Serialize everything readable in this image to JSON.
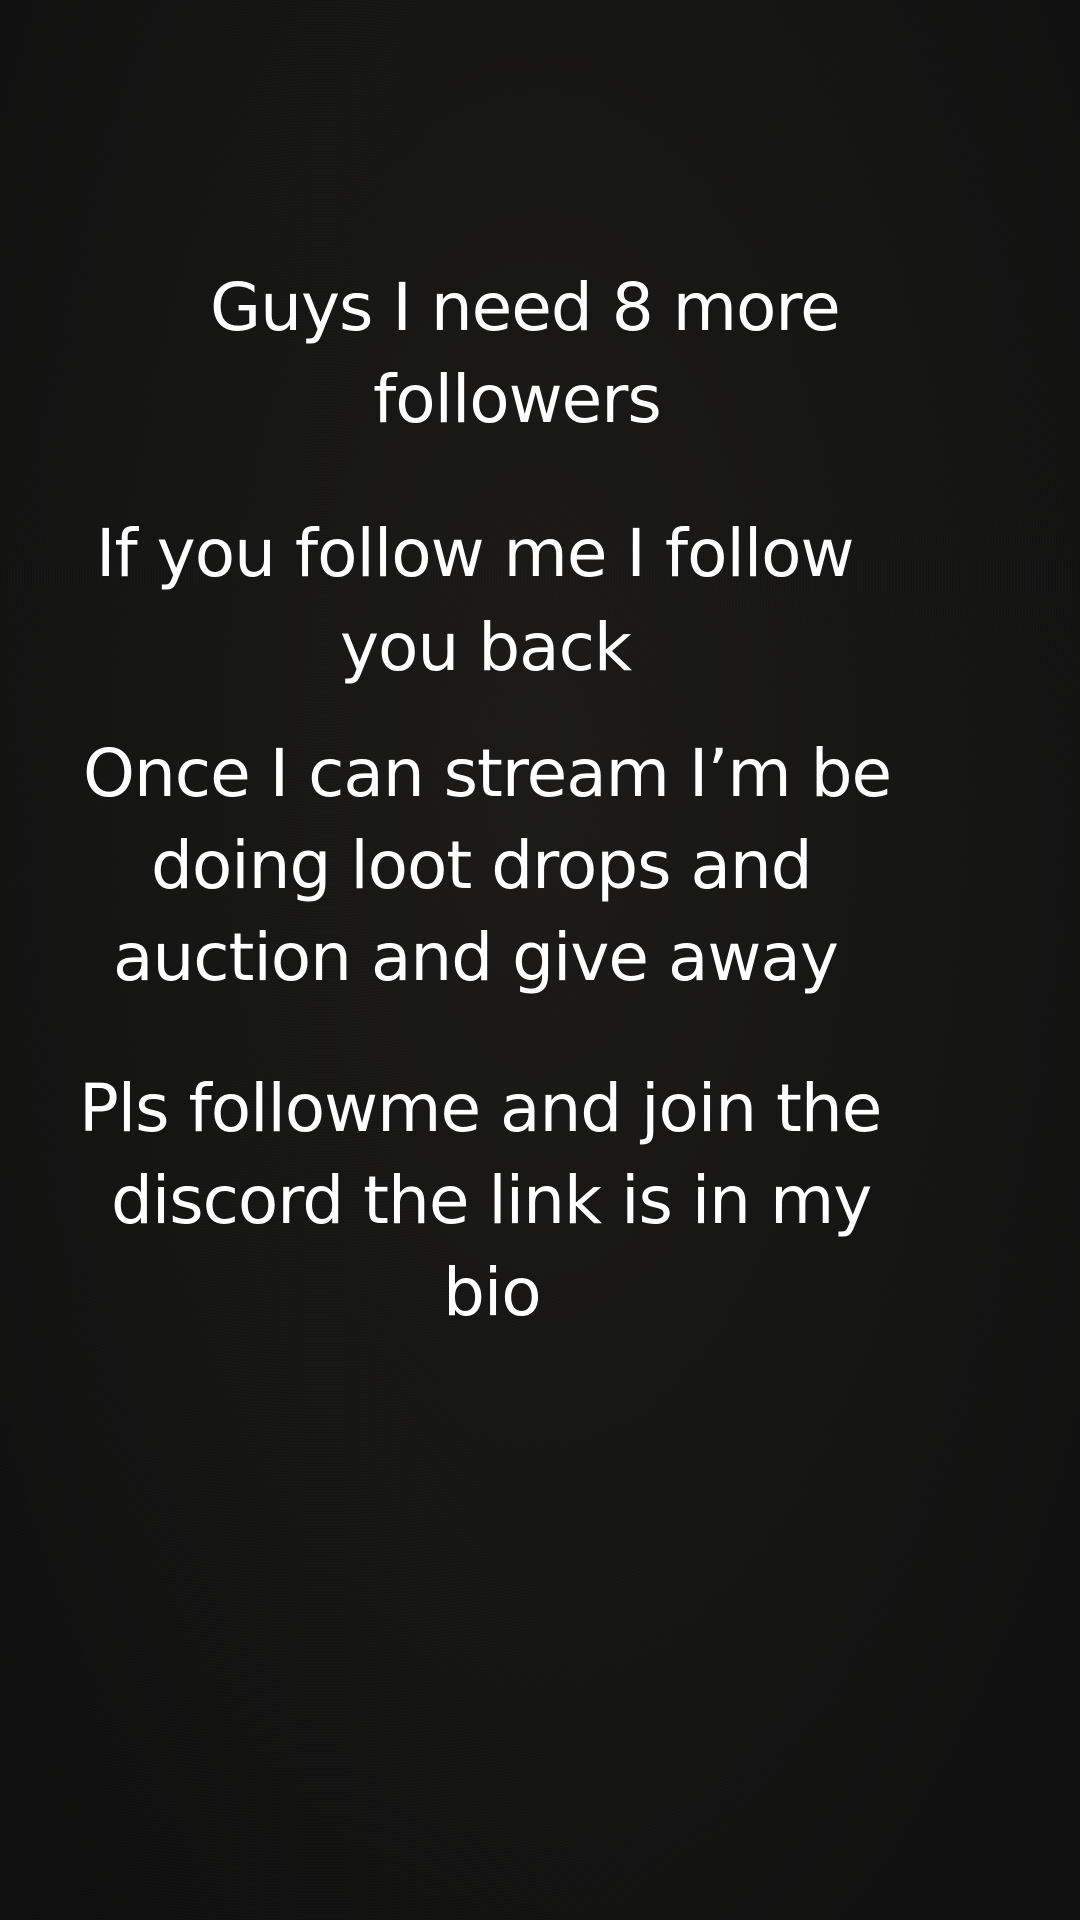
{
  "story": {
    "text_blocks": [
      {
        "id": "block-1",
        "lines": [
          "Guys I need 8 more",
          "followers"
        ]
      },
      {
        "id": "block-2",
        "lines": [
          "If you follow me I follow",
          "you back"
        ]
      },
      {
        "id": "block-3",
        "lines": [
          "Once I can stream I’m be",
          "doing loot drops and",
          "auction and give away"
        ]
      },
      {
        "id": "block-4",
        "lines": [
          "Pls followme and join the",
          "discord the link is in my",
          "bio"
        ]
      }
    ],
    "text_color": "#ffffff",
    "background_color": "#141414"
  }
}
